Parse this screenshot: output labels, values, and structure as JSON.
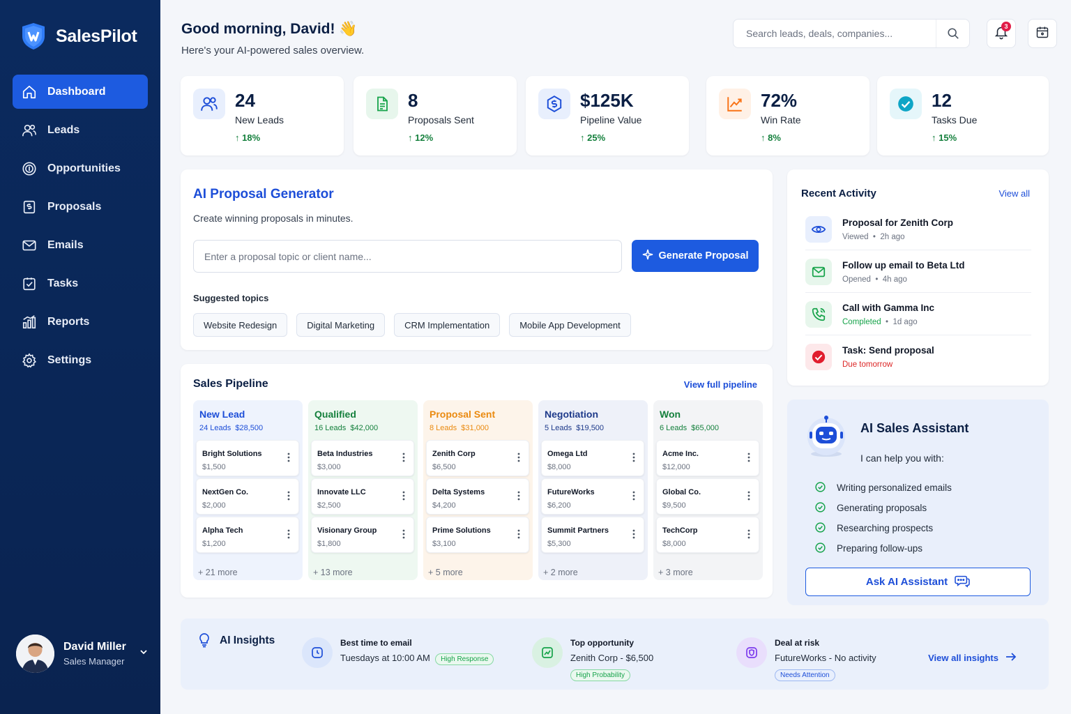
{
  "brand": {
    "name": "SalesPilot"
  },
  "nav": [
    {
      "label": "Dashboard",
      "icon": "home-icon"
    },
    {
      "label": "Leads",
      "icon": "users-icon"
    },
    {
      "label": "Opportunities",
      "icon": "dollar-circle-icon"
    },
    {
      "label": "Proposals",
      "icon": "file-dollar-icon"
    },
    {
      "label": "Emails",
      "icon": "mail-icon"
    },
    {
      "label": "Tasks",
      "icon": "checkbox-icon"
    },
    {
      "label": "Reports",
      "icon": "bar-chart-icon"
    },
    {
      "label": "Settings",
      "icon": "gear-icon"
    }
  ],
  "user": {
    "name": "David Miller",
    "role": "Sales Manager"
  },
  "header": {
    "greeting": "Good morning, David! 👋",
    "subtitle": "Here's your AI-powered sales overview.",
    "search_placeholder": "Search leads, deals, companies...",
    "notification_count": "3"
  },
  "stats": [
    {
      "value": "24",
      "label": "New Leads",
      "delta": "18%",
      "icon": "users-icon",
      "color": "#1d4ed8",
      "bg": "#e8effd"
    },
    {
      "value": "8",
      "label": "Proposals Sent",
      "delta": "12%",
      "icon": "document-icon",
      "color": "#16a34a",
      "bg": "#e7f6ec"
    },
    {
      "value": "$125K",
      "label": "Pipeline Value",
      "delta": "25%",
      "icon": "dollar-circle-icon",
      "color": "#1d4ed8",
      "bg": "#e8effd"
    },
    {
      "value": "72%",
      "label": "Win Rate",
      "delta": "8%",
      "icon": "trend-up-icon",
      "color": "#f97316",
      "bg": "#fff1e6"
    },
    {
      "value": "12",
      "label": "Tasks Due",
      "delta": "15%",
      "icon": "check-circle-icon",
      "color": "#0ea5c6",
      "bg": "#e5f6fa"
    }
  ],
  "proposal": {
    "title": "AI Proposal Generator",
    "subtitle": "Create winning proposals in minutes.",
    "input_placeholder": "Enter a proposal topic or client name...",
    "button": "Generate Proposal",
    "suggested_label": "Suggested topics",
    "topics": [
      "Website Redesign",
      "Digital Marketing",
      "CRM Implementation",
      "Mobile App Development"
    ]
  },
  "pipeline": {
    "title": "Sales Pipeline",
    "link": "View full pipeline",
    "stages": [
      {
        "name": "New Lead",
        "count": "24 Leads",
        "value": "$28,500",
        "color": "#1d4ed8",
        "bg": "#eef3fd",
        "deals": [
          {
            "name": "Bright Solutions",
            "value": "$1,500"
          },
          {
            "name": "NextGen Co.",
            "value": "$2,000"
          },
          {
            "name": "Alpha Tech",
            "value": "$1,200"
          }
        ],
        "more": "+ 21 more"
      },
      {
        "name": "Qualified",
        "count": "16 Leads",
        "value": "$42,000",
        "color": "#15803d",
        "bg": "#eef8f1",
        "deals": [
          {
            "name": "Beta Industries",
            "value": "$3,000"
          },
          {
            "name": "Innovate LLC",
            "value": "$2,500"
          },
          {
            "name": "Visionary Group",
            "value": "$1,800"
          }
        ],
        "more": "+ 13 more"
      },
      {
        "name": "Proposal Sent",
        "count": "8 Leads",
        "value": "$31,000",
        "color": "#ea8a10",
        "bg": "#fdf4ea",
        "deals": [
          {
            "name": "Zenith Corp",
            "value": "$6,500"
          },
          {
            "name": "Delta Systems",
            "value": "$4,200"
          },
          {
            "name": "Prime Solutions",
            "value": "$3,100"
          }
        ],
        "more": "+ 5 more"
      },
      {
        "name": "Negotiation",
        "count": "5 Leads",
        "value": "$19,500",
        "color": "#1e3a8a",
        "bg": "#eef1f9",
        "deals": [
          {
            "name": "Omega Ltd",
            "value": "$8,000"
          },
          {
            "name": "FutureWorks",
            "value": "$6,200"
          },
          {
            "name": "Summit Partners",
            "value": "$5,300"
          }
        ],
        "more": "+ 2 more"
      },
      {
        "name": "Won",
        "count": "6 Leads",
        "value": "$65,000",
        "color": "#15803d",
        "bg": "#f3f4f6",
        "deals": [
          {
            "name": "Acme Inc.",
            "value": "$12,000"
          },
          {
            "name": "Global Co.",
            "value": "$9,500"
          },
          {
            "name": "TechCorp",
            "value": "$8,000"
          }
        ],
        "more": "+ 3 more"
      }
    ]
  },
  "activity": {
    "title": "Recent Activity",
    "link": "View all",
    "items": [
      {
        "title": "Proposal for Zenith Corp",
        "status": "Viewed",
        "time": "2h ago",
        "icon": "eye-icon",
        "color": "#1d4ed8",
        "bg": "#e8effd",
        "status_color": "#6b7280"
      },
      {
        "title": "Follow up email to Beta Ltd",
        "status": "Opened",
        "time": "4h ago",
        "icon": "mail-icon",
        "color": "#16a34a",
        "bg": "#e7f6ec",
        "status_color": "#6b7280"
      },
      {
        "title": "Call with Gamma Inc",
        "status": "Completed",
        "time": "1d ago",
        "icon": "phone-icon",
        "color": "#16a34a",
        "bg": "#e7f6ec",
        "status_color": "#16a34a"
      },
      {
        "title": "Task: Send proposal",
        "status": "Due tomorrow",
        "time": "",
        "icon": "check-circle-icon",
        "color": "#e11d2e",
        "bg": "#fde8ea",
        "status_color": "#dc2626"
      }
    ]
  },
  "assistant": {
    "title": "AI Sales Assistant",
    "subtitle": "I can help you with:",
    "items": [
      "Writing personalized emails",
      "Generating proposals",
      "Researching prospects",
      "Preparing follow-ups"
    ],
    "button": "Ask AI Assistant"
  },
  "insights": {
    "title": "AI Insights",
    "items": [
      {
        "label": "Best time to email",
        "value": "Tuesdays at 10:00 AM",
        "tag": "High Response",
        "icon": "clock-icon",
        "color": "#1d4ed8"
      },
      {
        "label": "Top opportunity",
        "value": "Zenith Corp - $6,500",
        "tag": "High Probability",
        "icon": "chart-icon",
        "color": "#16a34a"
      },
      {
        "label": "Deal at risk",
        "value": "FutureWorks - No activity",
        "tag": "Needs Attention",
        "icon": "shield-icon",
        "color": "#7c3aed"
      }
    ],
    "link": "View all insights"
  }
}
